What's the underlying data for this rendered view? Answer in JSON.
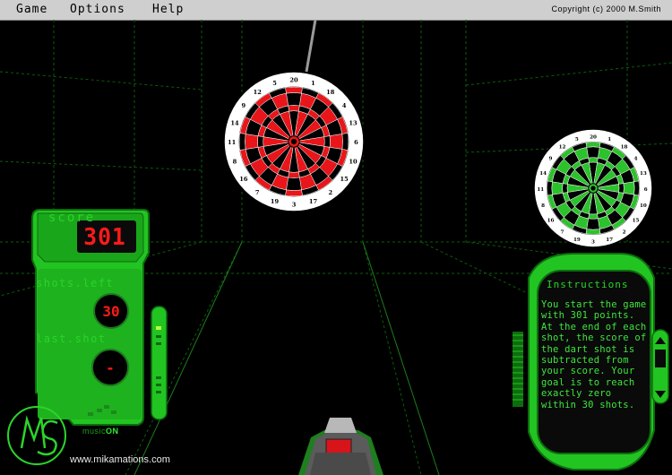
{
  "menu": {
    "game": "Game",
    "options": "Options",
    "help": "Help",
    "copyright": "Copyright (c) 2000  M.Smith"
  },
  "score_panel": {
    "score_label": "score",
    "score_value": "301",
    "shots_label": "shots.left",
    "shots_value": "30",
    "last_shot_label": "last.shot",
    "last_shot_value": "-",
    "music_label": "music",
    "music_state": "ON"
  },
  "instructions": {
    "title": "Instructions",
    "body": "You start the game with 301 points. At the end of each shot, the score of the dart shot is subtracted from your score. Your goal is to reach exactly zero within 30 shots."
  },
  "dartboard_numbers": [
    "20",
    "1",
    "18",
    "4",
    "13",
    "6",
    "10",
    "15",
    "2",
    "17",
    "3",
    "19",
    "7",
    "16",
    "8",
    "11",
    "14",
    "9",
    "12",
    "5"
  ],
  "colors": {
    "panel_green": "#1fc91f",
    "board_red": "#e8161a",
    "board_green": "#2cc22c",
    "score_red": "#ff1a1a"
  },
  "logo_text": "MS",
  "site_url": "www.mikamations.com"
}
